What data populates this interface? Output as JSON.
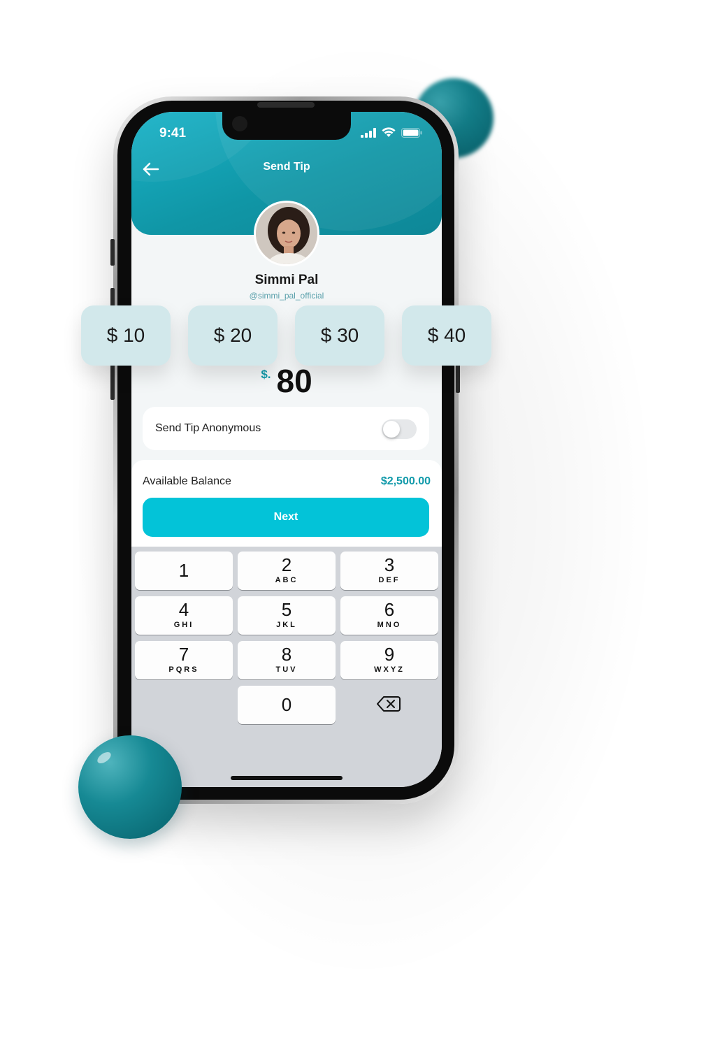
{
  "status": {
    "time": "9:41"
  },
  "header": {
    "title": "Send Tip"
  },
  "profile": {
    "name": "Simmi Pal",
    "handle": "@simmi_pal_official"
  },
  "quick_amounts": [
    "$ 10",
    "$ 20",
    "$ 30",
    "$ 40"
  ],
  "amount": {
    "currency": "$.",
    "value": "80"
  },
  "anonymous": {
    "label": "Send Tip Anonymous",
    "enabled": false
  },
  "balance": {
    "label": "Available Balance",
    "value": "$2,500.00"
  },
  "next_label": "Next",
  "keypad": {
    "keys": [
      {
        "digit": "1",
        "letters": ""
      },
      {
        "digit": "2",
        "letters": "ABC"
      },
      {
        "digit": "3",
        "letters": "DEF"
      },
      {
        "digit": "4",
        "letters": "GHI"
      },
      {
        "digit": "5",
        "letters": "JKL"
      },
      {
        "digit": "6",
        "letters": "MNO"
      },
      {
        "digit": "7",
        "letters": "PQRS"
      },
      {
        "digit": "8",
        "letters": "TUV"
      },
      {
        "digit": "9",
        "letters": "WXYZ"
      },
      {
        "digit": "0",
        "letters": ""
      }
    ]
  },
  "colors": {
    "accent": "#03c3d8",
    "teal": "#119aaa",
    "header": "#1096a6",
    "chip": "#d2e8eb"
  },
  "icons": [
    "back-arrow-icon",
    "signal-icon",
    "wifi-icon",
    "battery-icon",
    "backspace-icon"
  ]
}
